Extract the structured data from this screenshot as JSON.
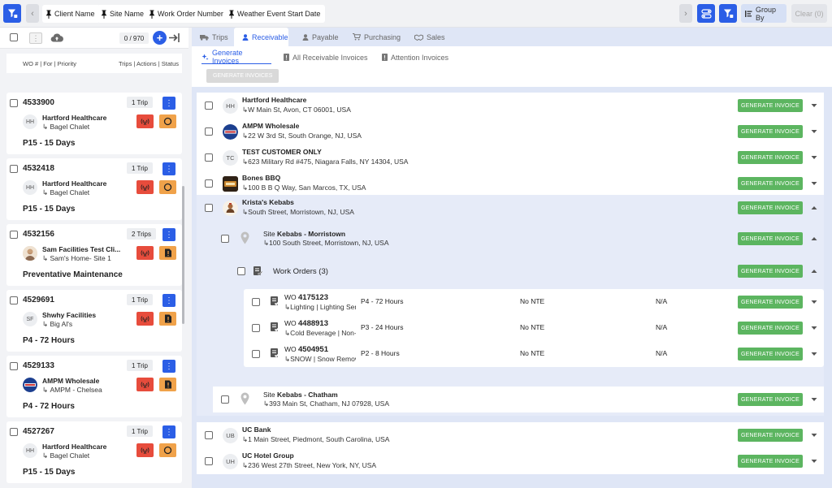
{
  "topbar": {
    "filter_chips": [
      "Client Name",
      "Site Name",
      "Work Order Number",
      "Weather Event Start Date"
    ],
    "group_by_label": "Group By",
    "clear_label": "Clear (0)",
    "prev_glyph": "‹",
    "next_glyph": "›"
  },
  "left": {
    "count": "0 / 970",
    "columns_left": "WO # | For | Priority",
    "columns_right": "Trips | Actions | Status",
    "cards": [
      {
        "wo": "4533900",
        "trips": "1 Trip",
        "avatar": "HH",
        "client": "Hartford Healthcare",
        "site": "Bagel Chalet",
        "priority": "P15 - 15 Days",
        "status_icon": "circle"
      },
      {
        "wo": "4532418",
        "trips": "1 Trip",
        "avatar": "HH",
        "client": "Hartford Healthcare",
        "site": "Bagel Chalet",
        "priority": "P15 - 15 Days",
        "status_icon": "circle"
      },
      {
        "wo": "4532156",
        "trips": "2 Trips",
        "avatar": "",
        "client": "Sam Facilities Test Cli...",
        "site": "Sam's Home- Site 1",
        "priority": "Preventative Maintenance",
        "status_icon": "doc"
      },
      {
        "wo": "4529691",
        "trips": "1 Trip",
        "avatar": "SF",
        "client": "Shwhy Facilities",
        "site": "Big Al's",
        "priority": "P4 - 72 Hours",
        "status_icon": "doc"
      },
      {
        "wo": "4529133",
        "trips": "1 Trip",
        "avatar": "",
        "client": "AMPM Wholesale",
        "site": "AMPM - Chelsea",
        "priority": "P4 - 72 Hours",
        "status_icon": "doc"
      },
      {
        "wo": "4527267",
        "trips": "1 Trip",
        "avatar": "HH",
        "client": "Hartford Healthcare",
        "site": "Bagel Chalet",
        "priority": "P15 - 15 Days",
        "status_icon": "circle"
      }
    ]
  },
  "tabs": [
    "Trips",
    "Receivable",
    "Payable",
    "Purchasing",
    "Sales"
  ],
  "subtabs": [
    "Generate Invoices",
    "All Receivable Invoices",
    "Attention Invoices"
  ],
  "generate_all_label": "GENERATE INVOICES",
  "generate_label": "GENERATE INVOICE",
  "clients": [
    {
      "avatar": "HH",
      "name": "Hartford Healthcare",
      "address": "W Main St, Avon, CT 06001, USA"
    },
    {
      "avatar": "",
      "name": "AMPM Wholesale",
      "address": "22 W 3rd St, South Orange, NJ, USA"
    },
    {
      "avatar": "TC",
      "name": "TEST CUSTOMER ONLY",
      "address": "623 Military Rd #475, Niagara Falls, NY 14304, USA"
    },
    {
      "avatar": "",
      "name": "Bones BBQ",
      "address": "100 B B Q Way, San Marcos, TX, USA"
    },
    {
      "avatar": "",
      "name": "Krista's Kebabs",
      "address": "South Street, Morristown, NJ, USA"
    }
  ],
  "site1": {
    "prefix": "Site",
    "name": "Kebabs - Morristown",
    "address": "100 South Street, Morristown, NJ, USA"
  },
  "wo_header": "Work Orders (3)",
  "work_orders": [
    {
      "prefix": "WO",
      "num": "4175123",
      "category": "Lighting | Lighting Service",
      "priority": "P4 - 72 Hours",
      "nte": "No NTE",
      "na": "N/A"
    },
    {
      "prefix": "WO",
      "num": "4488913",
      "category": "Cold Beverage | Non-Alcoholic",
      "priority": "P3 - 24 Hours",
      "nte": "No NTE",
      "na": "N/A"
    },
    {
      "prefix": "WO",
      "num": "4504951",
      "category": "SNOW | Snow Removal",
      "priority": "P2 - 8 Hours",
      "nte": "No NTE",
      "na": "N/A"
    }
  ],
  "site2": {
    "prefix": "Site",
    "name": "Kebabs - Chatham",
    "address": "393 Main St, Chatham, NJ 07928, USA"
  },
  "clients_bottom": [
    {
      "avatar": "UB",
      "name": "UC Bank",
      "address": "1 Main Street, Piedmont, South Carolina, USA"
    },
    {
      "avatar": "UH",
      "name": "UC Hotel Group",
      "address": "236 West 27th Street, New York, NY, USA"
    }
  ],
  "arrow_glyph": "↳",
  "colors": {
    "blue": "#2b5ee6",
    "green": "#5cb560",
    "red": "#e74c3c",
    "orange": "#f0a24a"
  }
}
